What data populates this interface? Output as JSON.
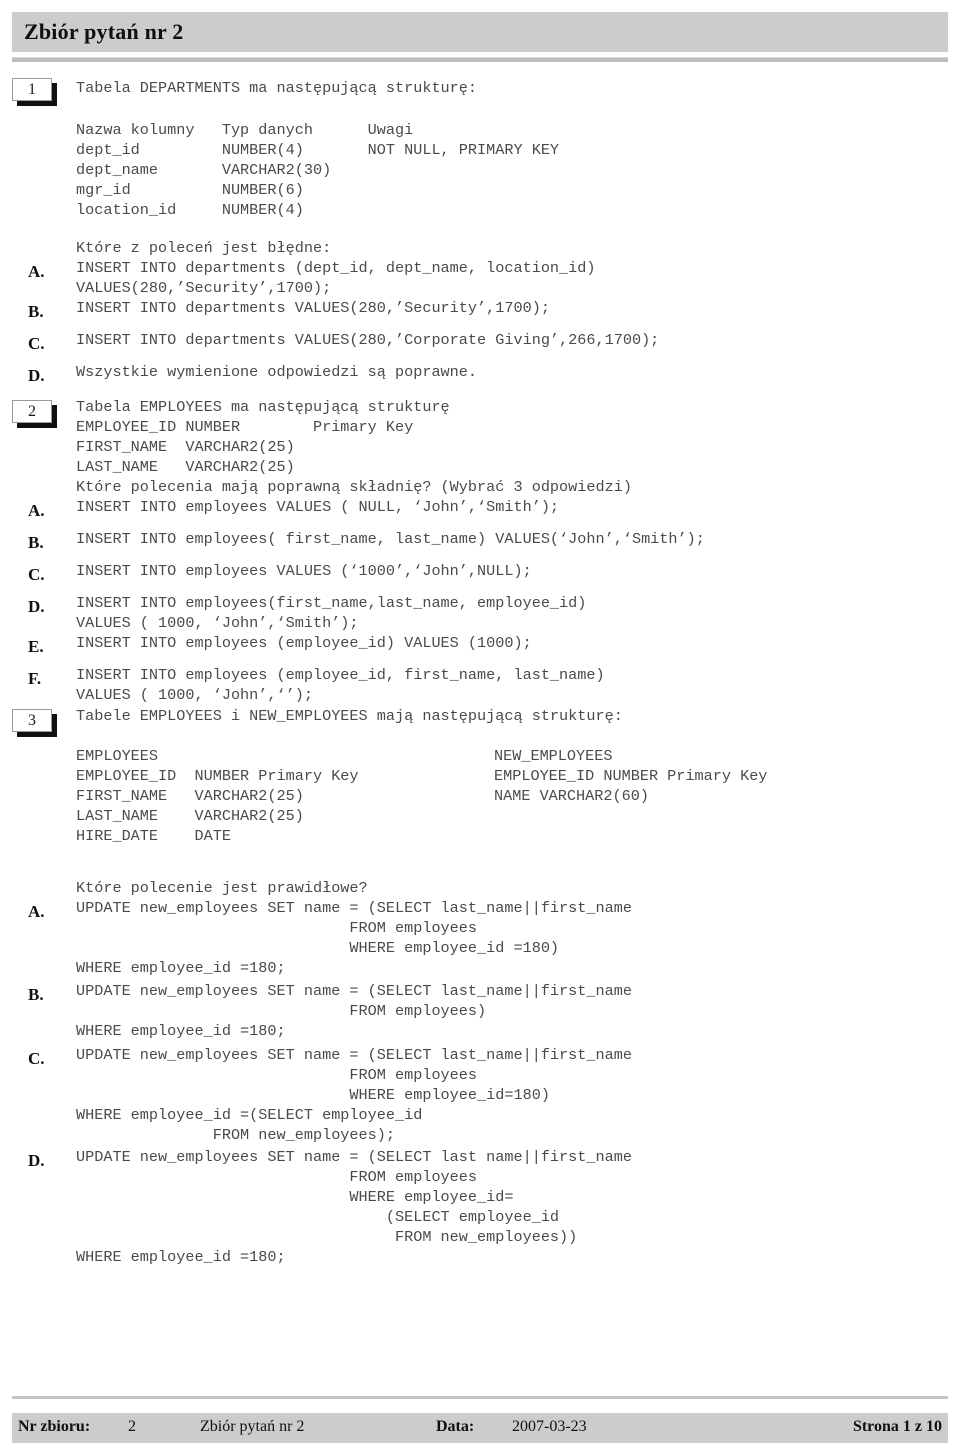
{
  "header": {
    "title": "Zbiór pytań nr 2"
  },
  "questions": [
    {
      "number": "1",
      "stem": "Tabela DEPARTMENTS ma następującą strukturę:",
      "table": "Nazwa kolumny   Typ danych      Uwagi\ndept_id         NUMBER(4)       NOT NULL, PRIMARY KEY\ndept_name       VARCHAR2(30)\nmgr_id          NUMBER(6)\nlocation_id     NUMBER(4)",
      "prompt": "Które z poleceń jest błędne:",
      "options": [
        {
          "letter": "A.",
          "text": "INSERT INTO departments (dept_id, dept_name, location_id)\nVALUES(280,’Security’,1700);"
        },
        {
          "letter": "B.",
          "text": "INSERT INTO departments VALUES(280,’Security’,1700);"
        },
        {
          "letter": "C.",
          "text": "INSERT INTO departments VALUES(280,’Corporate Giving’,266,1700);"
        },
        {
          "letter": "D.",
          "text": "Wszystkie wymienione odpowiedzi są poprawne."
        }
      ]
    },
    {
      "number": "2",
      "stem": "Tabela EMPLOYEES ma następującą strukturę",
      "table": "EMPLOYEE_ID NUMBER        Primary Key\nFIRST_NAME  VARCHAR2(25)\nLAST_NAME   VARCHAR2(25)",
      "prompt": "Które polecenia mają poprawną składnię? (Wybrać 3 odpowiedzi)",
      "options": [
        {
          "letter": "A.",
          "text": "INSERT INTO employees VALUES ( NULL, ‘John’,‘Smith’);"
        },
        {
          "letter": "B.",
          "text": "INSERT INTO employees( first_name, last_name) VALUES(‘John’,‘Smith’);"
        },
        {
          "letter": "C.",
          "text": "INSERT INTO employees VALUES (‘1000’,‘John’,NULL);"
        },
        {
          "letter": "D.",
          "text": "INSERT INTO employees(first_name,last_name, employee_id)\nVALUES ( 1000, ‘John’,‘Smith’);"
        },
        {
          "letter": "E.",
          "text": "INSERT INTO employees (employee_id) VALUES (1000);"
        },
        {
          "letter": "F.",
          "text": "INSERT INTO employees (employee_id, first_name, last_name)\nVALUES ( 1000, ‘John’,‘’);"
        }
      ]
    },
    {
      "number": "3",
      "stem": "Tabele EMPLOYEES i NEW_EMPLOYEES mają następującą strukturę:",
      "table_left": "EMPLOYEES\nEMPLOYEE_ID  NUMBER Primary Key\nFIRST_NAME   VARCHAR2(25)\nLAST_NAME    VARCHAR2(25)\nHIRE_DATE    DATE",
      "table_right": "NEW_EMPLOYEES\nEMPLOYEE_ID NUMBER Primary Key\nNAME VARCHAR2(60)",
      "prompt": "Które polecenie jest prawidłowe?",
      "options": [
        {
          "letter": "A.",
          "text": "UPDATE new_employees SET name = (SELECT last_name||first_name\n                              FROM employees\n                              WHERE employee_id =180)\nWHERE employee_id =180;"
        },
        {
          "letter": "B.",
          "text": "UPDATE new_employees SET name = (SELECT last_name||first_name\n                              FROM employees)\nWHERE employee_id =180;"
        },
        {
          "letter": "C.",
          "text": "UPDATE new_employees SET name = (SELECT last_name||first_name\n                              FROM employees\n                              WHERE employee_id=180)\nWHERE employee_id =(SELECT employee_id\n               FROM new_employees);"
        },
        {
          "letter": "D.",
          "text": "UPDATE new_employees SET name = (SELECT last name||first_name\n                              FROM employees\n                              WHERE employee_id=\n                                  (SELECT employee_id\n                                   FROM new_employees))\nWHERE employee_id =180;"
        }
      ]
    }
  ],
  "footer": {
    "set_label": "Nr zbioru:",
    "set_value": "2",
    "set_title": "Zbiór pytań nr 2",
    "date_label": "Data:",
    "date_value": "2007-03-23",
    "page_info": "Strona 1 z 10"
  }
}
